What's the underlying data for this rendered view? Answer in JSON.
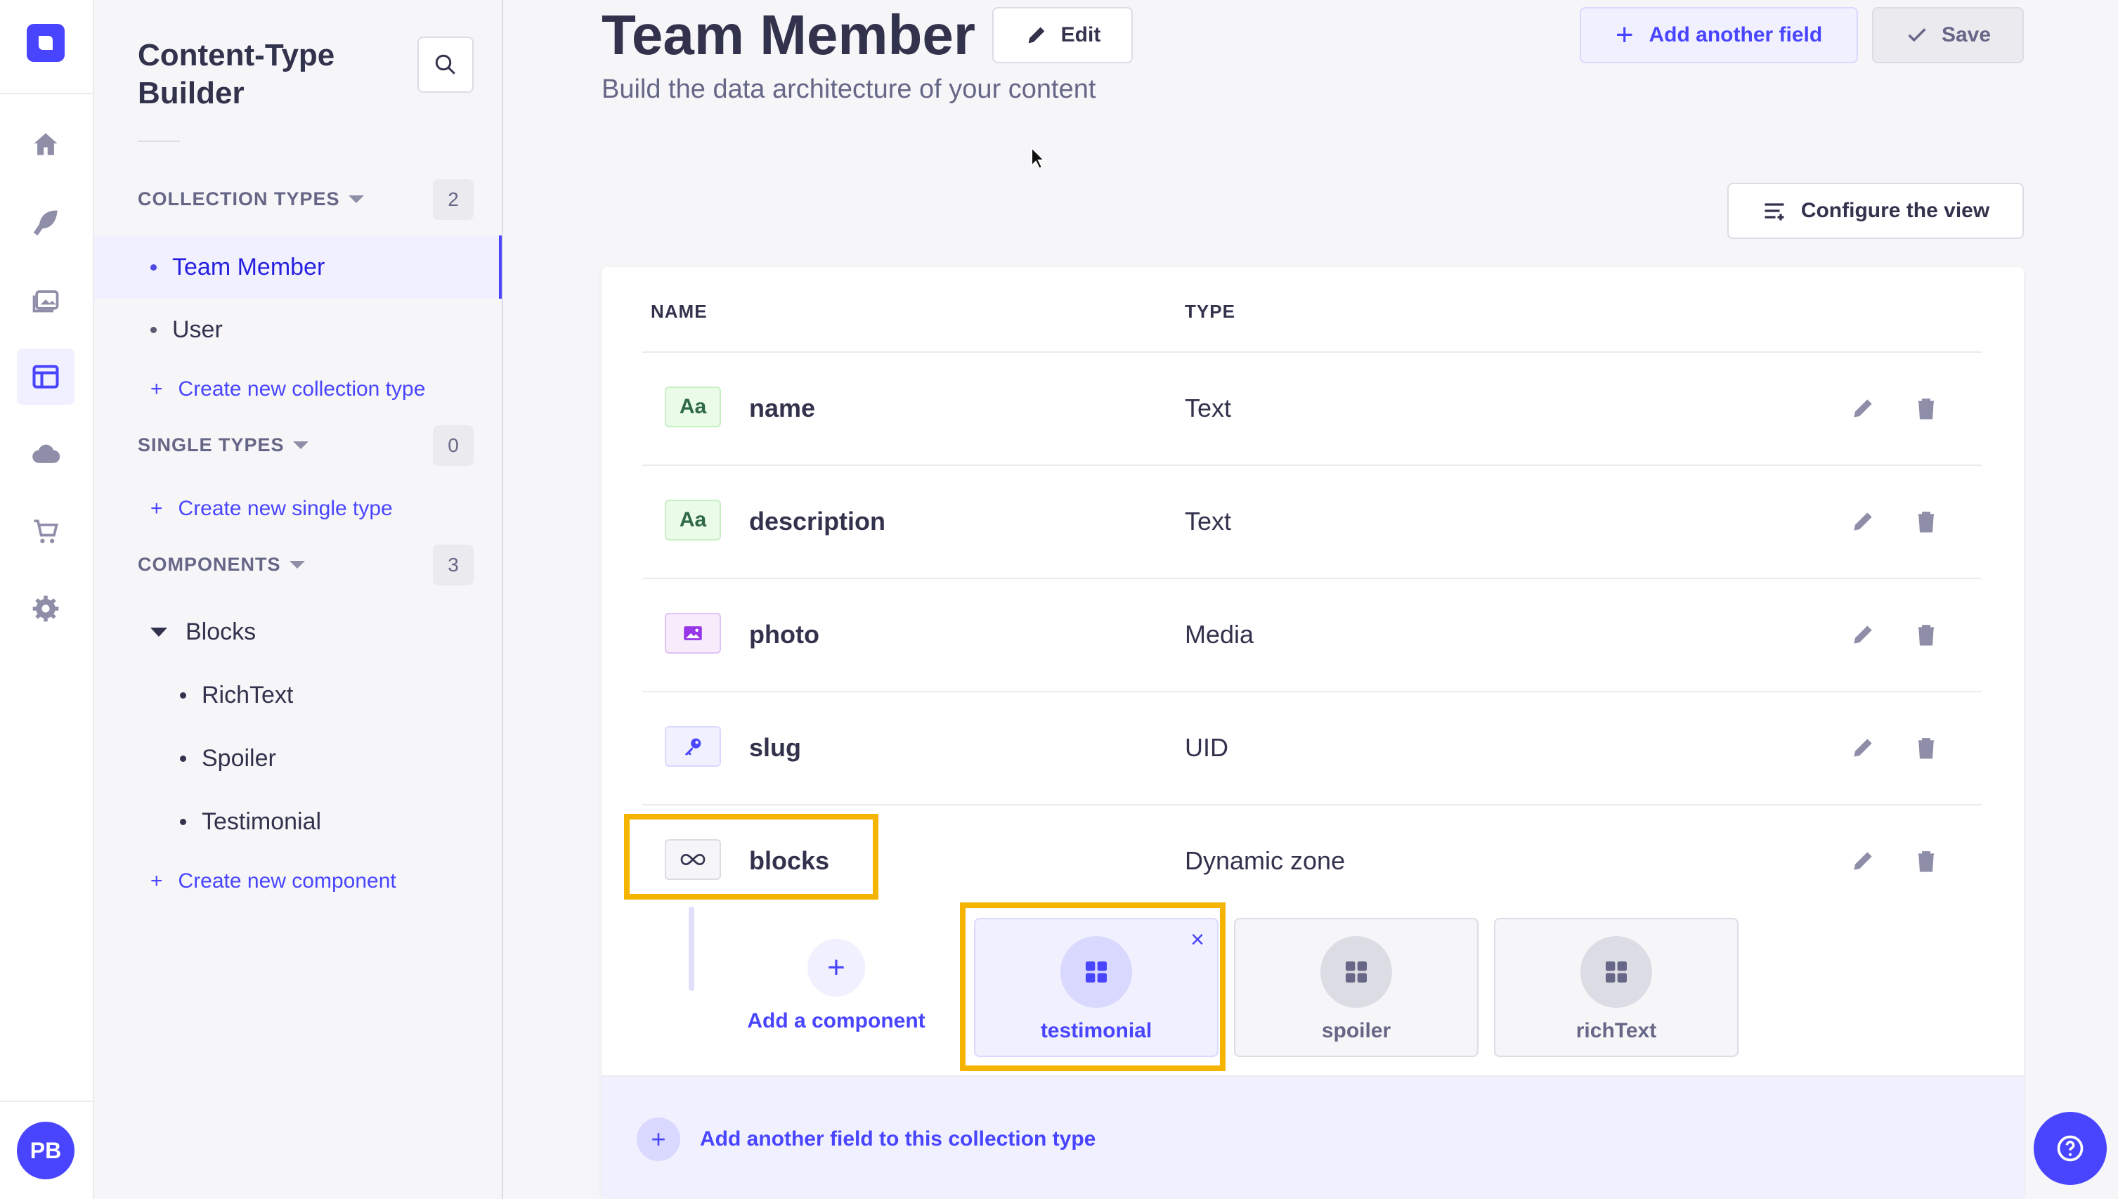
{
  "rail": {
    "avatar_initials": "PB",
    "icons": [
      "logo-icon",
      "home-icon",
      "feather-icon",
      "media-library-icon",
      "content-type-builder-icon",
      "cloud-icon",
      "cart-icon",
      "settings-icon"
    ]
  },
  "subnav": {
    "title": "Content-Type Builder",
    "collection_types": {
      "label": "COLLECTION TYPES",
      "count": "2",
      "items": [
        "Team Member",
        "User"
      ],
      "create_label": "Create new collection type"
    },
    "single_types": {
      "label": "SINGLE TYPES",
      "count": "0",
      "create_label": "Create new single type"
    },
    "components": {
      "label": "COMPONENTS",
      "count": "3",
      "group": "Blocks",
      "items": [
        "RichText",
        "Spoiler",
        "Testimonial"
      ],
      "create_label": "Create new component"
    }
  },
  "header": {
    "title": "Team Member",
    "edit_label": "Edit",
    "subtitle": "Build the data architecture of your content",
    "add_field_label": "Add another field",
    "save_label": "Save",
    "configure_label": "Configure the view"
  },
  "table": {
    "columns": [
      "NAME",
      "TYPE"
    ],
    "rows": [
      {
        "icon_text": "Aa",
        "icon": "text-icon",
        "name": "name",
        "type": "Text"
      },
      {
        "icon_text": "Aa",
        "icon": "text-icon",
        "name": "description",
        "type": "Text"
      },
      {
        "icon_text": "",
        "icon": "media-icon",
        "name": "photo",
        "type": "Media"
      },
      {
        "icon_text": "",
        "icon": "key-icon",
        "name": "slug",
        "type": "UID"
      },
      {
        "icon_text": "",
        "icon": "infinity-icon",
        "name": "blocks",
        "type": "Dynamic zone"
      }
    ],
    "add_component_label": "Add a component",
    "components": [
      "testimonial",
      "spoiler",
      "richText"
    ],
    "footer_label": "Add another field to this collection type"
  },
  "colors": {
    "primary": "#4945ff",
    "highlight": "#f5b400",
    "text": "#32324d",
    "muted": "#666687"
  }
}
